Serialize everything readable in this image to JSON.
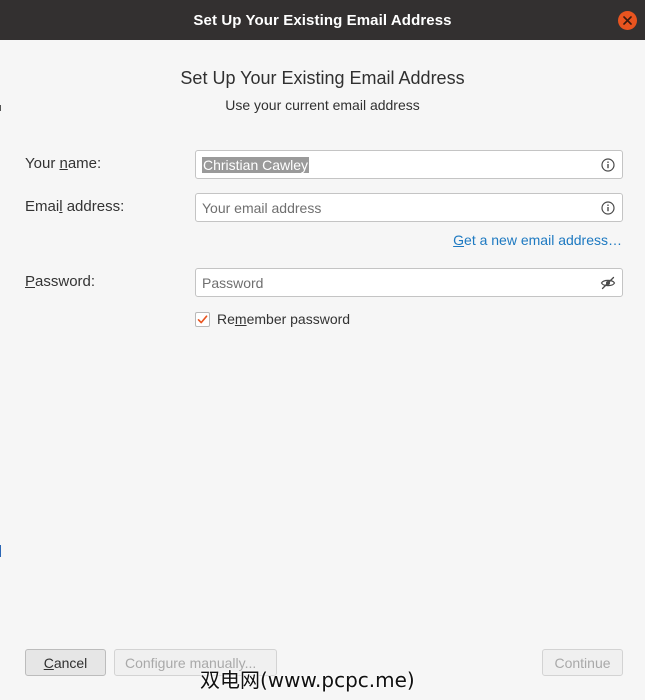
{
  "window": {
    "title": "Set Up Your Existing Email Address"
  },
  "header": {
    "heading": "Set Up Your Existing Email Address",
    "subheading": "Use your current email address"
  },
  "form": {
    "name": {
      "label_before": "Your ",
      "label_accel": "n",
      "label_after": "ame:",
      "value": "Christian Cawley",
      "icon": "info-icon"
    },
    "email": {
      "label_before": "Emai",
      "label_accel": "l",
      "label_after": " address:",
      "placeholder": "Your email address",
      "icon": "info-icon"
    },
    "new_email_link": {
      "accel": "G",
      "rest": "et a new email address…"
    },
    "password": {
      "label_accel": "P",
      "label_after": "assword:",
      "placeholder": "Password",
      "icon": "eye-slash-icon"
    },
    "remember": {
      "label_before": "Re",
      "label_accel": "m",
      "label_after": "ember password",
      "checked": true
    }
  },
  "buttons": {
    "cancel_accel": "C",
    "cancel_rest": "ancel",
    "configure": "Configure manually...",
    "continue": "Continue"
  },
  "watermark": "双电网(www.pcpc.me)",
  "colors": {
    "titlebar": "#333030",
    "close": "#e9541f",
    "link": "#1d79c1",
    "check": "#e9541f"
  }
}
